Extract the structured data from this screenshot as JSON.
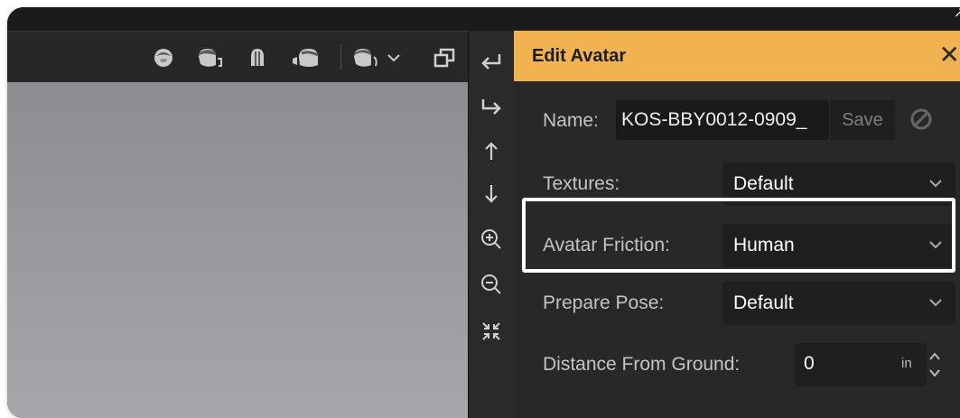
{
  "panel": {
    "title": "Edit Avatar",
    "close_icon": "close-icon"
  },
  "fields": {
    "name": {
      "label": "Name:",
      "value": "KOS-BBY0012-0909_",
      "save_label": "Save"
    },
    "textures": {
      "label": "Textures:",
      "value": "Default"
    },
    "friction": {
      "label": "Avatar Friction:",
      "value": "Human"
    },
    "pose": {
      "label": "Prepare Pose:",
      "value": "Default"
    },
    "distance": {
      "label": "Distance From Ground:",
      "value": "0",
      "unit": "in"
    }
  },
  "toolbar": {
    "icons": [
      "head-front-icon",
      "head-side-icon",
      "head-back-icon",
      "head-side-right-icon",
      "head-dropdown-icon",
      "window-toggle-icon"
    ]
  },
  "side_strip": {
    "icons": [
      "undo-icon",
      "redo-icon",
      "arrow-up-icon",
      "arrow-down-icon",
      "zoom-in-icon",
      "zoom-out-icon",
      "fit-view-icon"
    ]
  },
  "colors": {
    "header": "#f0b34f",
    "panel": "#282828",
    "highlight": "#ffffff"
  }
}
